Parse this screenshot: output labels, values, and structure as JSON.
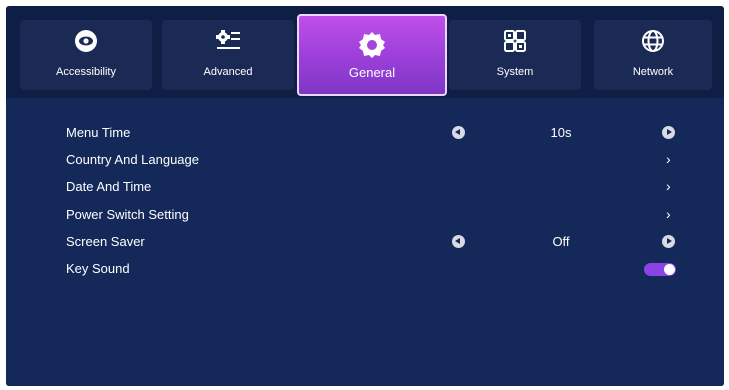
{
  "tabs": [
    {
      "label": "Accessibility",
      "icon": "eye-icon"
    },
    {
      "label": "Advanced",
      "icon": "advanced-settings-icon"
    },
    {
      "label": "General",
      "icon": "gear-icon",
      "active": true
    },
    {
      "label": "System",
      "icon": "system-grid-icon"
    },
    {
      "label": "Network",
      "icon": "globe-icon"
    }
  ],
  "settings": [
    {
      "label": "Menu Time",
      "type": "selector",
      "value": "10s"
    },
    {
      "label": "Country And Language",
      "type": "submenu"
    },
    {
      "label": "Date And Time",
      "type": "submenu"
    },
    {
      "label": "Power Switch Setting",
      "type": "submenu"
    },
    {
      "label": "Screen Saver",
      "type": "selector",
      "value": "Off"
    },
    {
      "label": "Key Sound",
      "type": "toggle",
      "on": true
    }
  ],
  "colors": {
    "background": "#0e1e45",
    "panel": "#14285a",
    "tab": "#1b2a55",
    "accent": "#9a3fd8",
    "toggle_on": "#8a44e6"
  }
}
